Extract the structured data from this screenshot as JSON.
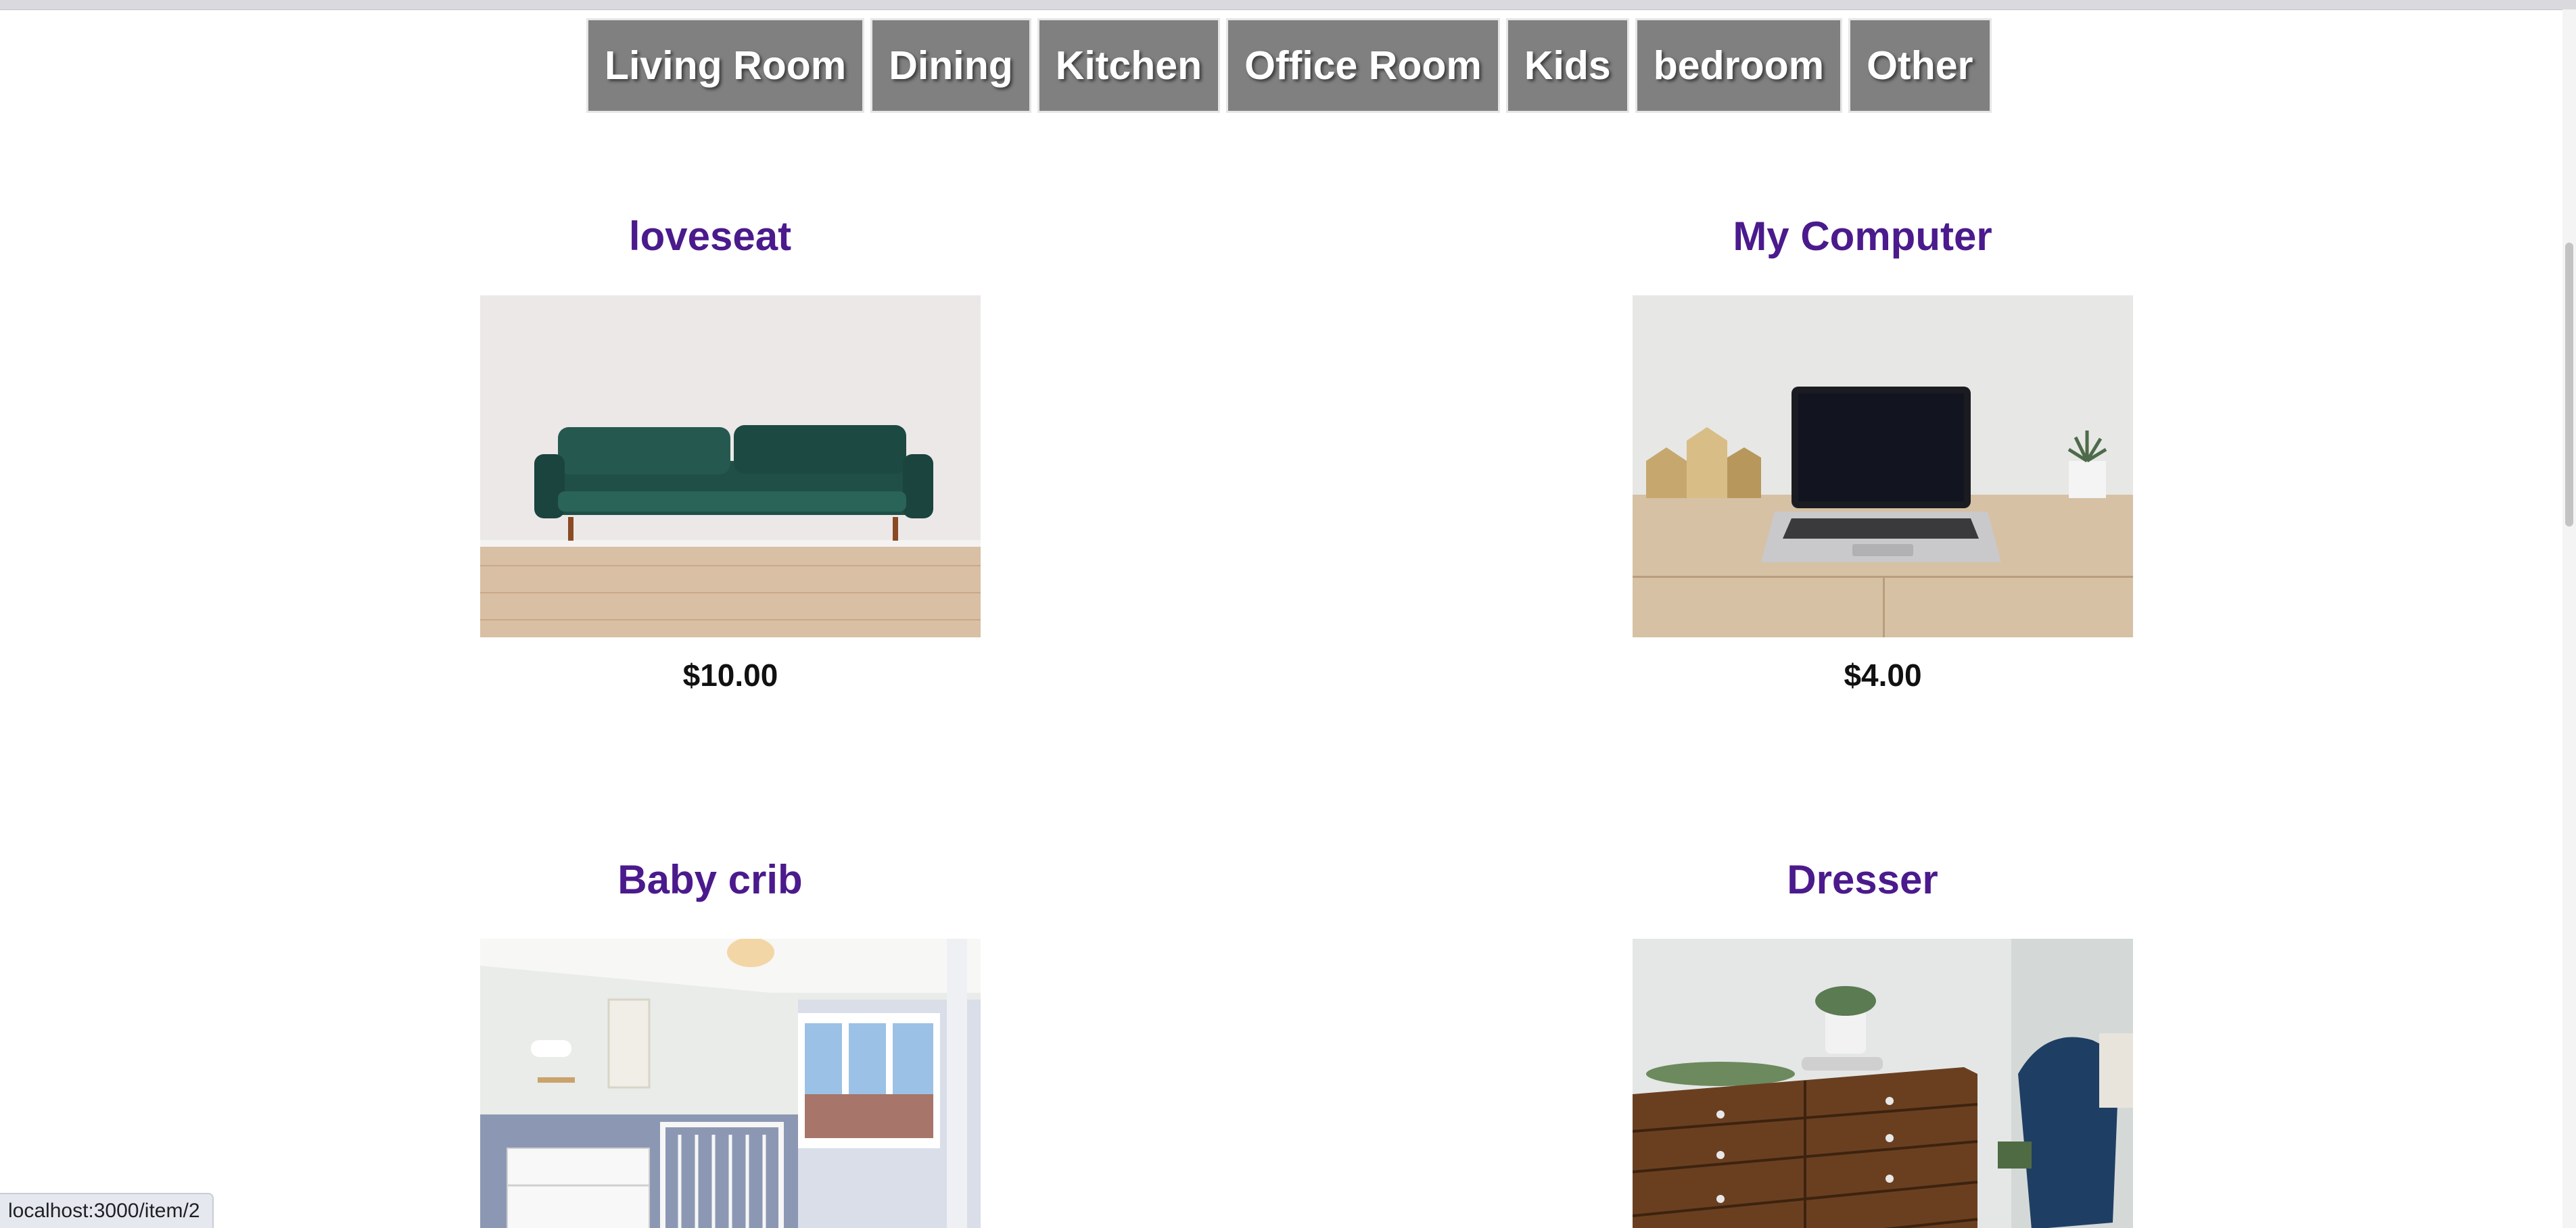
{
  "nav": {
    "items": [
      {
        "label": "Living Room"
      },
      {
        "label": "Dining"
      },
      {
        "label": "Kitchen"
      },
      {
        "label": "Office Room"
      },
      {
        "label": "Kids"
      },
      {
        "label": "bedroom"
      },
      {
        "label": "Other"
      }
    ]
  },
  "items": [
    {
      "title": "loveseat",
      "price": "$10.00"
    },
    {
      "title": "My Computer",
      "price": "$4.00"
    },
    {
      "title": "Baby crib"
    },
    {
      "title": "Dresser"
    }
  ],
  "status_bar": {
    "url": "localhost:3000/item/2"
  },
  "colors": {
    "nav_bg": "#808080",
    "title": "#4b1a8c"
  }
}
